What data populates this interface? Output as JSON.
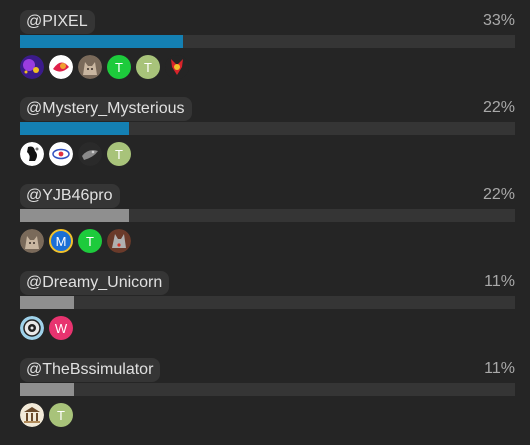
{
  "poll": {
    "options": [
      {
        "label": "@PIXEL",
        "percent_text": "33%",
        "percent": 33,
        "bar_color": "#1480b3",
        "voters": [
          {
            "kind": "image",
            "icon": "purple-galaxy-avatar-icon",
            "colors": [
              "#3b1b8a",
              "#9a3ce0",
              "#f0c020"
            ]
          },
          {
            "kind": "image",
            "icon": "colorful-art-avatar-icon",
            "colors": [
              "#ffffff",
              "#e0204a",
              "#f0a030"
            ]
          },
          {
            "kind": "image",
            "icon": "cat-photo-avatar-icon",
            "colors": [
              "#7a6a5a",
              "#c9b6a0",
              "#3a2f28"
            ]
          },
          {
            "kind": "letter",
            "letter": "T",
            "color": "#1dcb3c"
          },
          {
            "kind": "letter",
            "letter": "T",
            "color": "#a8c37a"
          },
          {
            "kind": "image",
            "icon": "red-character-avatar-icon",
            "colors": [
              "#252525",
              "#d8242a",
              "#f2c02a"
            ]
          }
        ]
      },
      {
        "label": "@Mystery_Mysterious",
        "percent_text": "22%",
        "percent": 22,
        "bar_color": "#1480b3",
        "voters": [
          {
            "kind": "image",
            "icon": "silhouette-avatar-icon",
            "colors": [
              "#ffffff",
              "#111111",
              "#777777"
            ]
          },
          {
            "kind": "image",
            "icon": "eye-symbol-avatar-icon",
            "colors": [
              "#ffffff",
              "#3050c0",
              "#e03040"
            ]
          },
          {
            "kind": "image",
            "icon": "dark-creature-avatar-icon",
            "colors": [
              "#2a2a2a",
              "#8a8a8a",
              "#cfcfcf"
            ]
          },
          {
            "kind": "letter",
            "letter": "T",
            "color": "#a8c37a"
          }
        ]
      },
      {
        "label": "@YJB46pro",
        "percent_text": "22%",
        "percent": 22,
        "bar_color": "#8f8f8f",
        "voters": [
          {
            "kind": "image",
            "icon": "cat-photo-avatar-icon",
            "colors": [
              "#7a6a5a",
              "#c9b6a0",
              "#3a2f28"
            ]
          },
          {
            "kind": "letter",
            "letter": "M",
            "color": "#1a6fd6",
            "ring": "#f2c22b"
          },
          {
            "kind": "letter",
            "letter": "T",
            "color": "#1dcb3c"
          },
          {
            "kind": "image",
            "icon": "wolf-photo-avatar-icon",
            "colors": [
              "#6a3a2a",
              "#b0b0b0",
              "#d8342a"
            ]
          }
        ]
      },
      {
        "label": "@Dreamy_Unicorn",
        "percent_text": "11%",
        "percent": 11,
        "bar_color": "#8f8f8f",
        "voters": [
          {
            "kind": "image",
            "icon": "robot-avatar-icon",
            "colors": [
              "#9fd2ea",
              "#222222",
              "#e8e8e8"
            ]
          },
          {
            "kind": "letter",
            "letter": "W",
            "color": "#e8336f"
          }
        ]
      },
      {
        "label": "@TheBssimulator",
        "percent_text": "11%",
        "percent": 11,
        "bar_color": "#8f8f8f",
        "voters": [
          {
            "kind": "image",
            "icon": "building-avatar-icon",
            "colors": [
              "#f2ead8",
              "#6a4a2a",
              "#b08a5a"
            ]
          },
          {
            "kind": "letter",
            "letter": "T",
            "color": "#a8c37a"
          }
        ]
      }
    ]
  }
}
